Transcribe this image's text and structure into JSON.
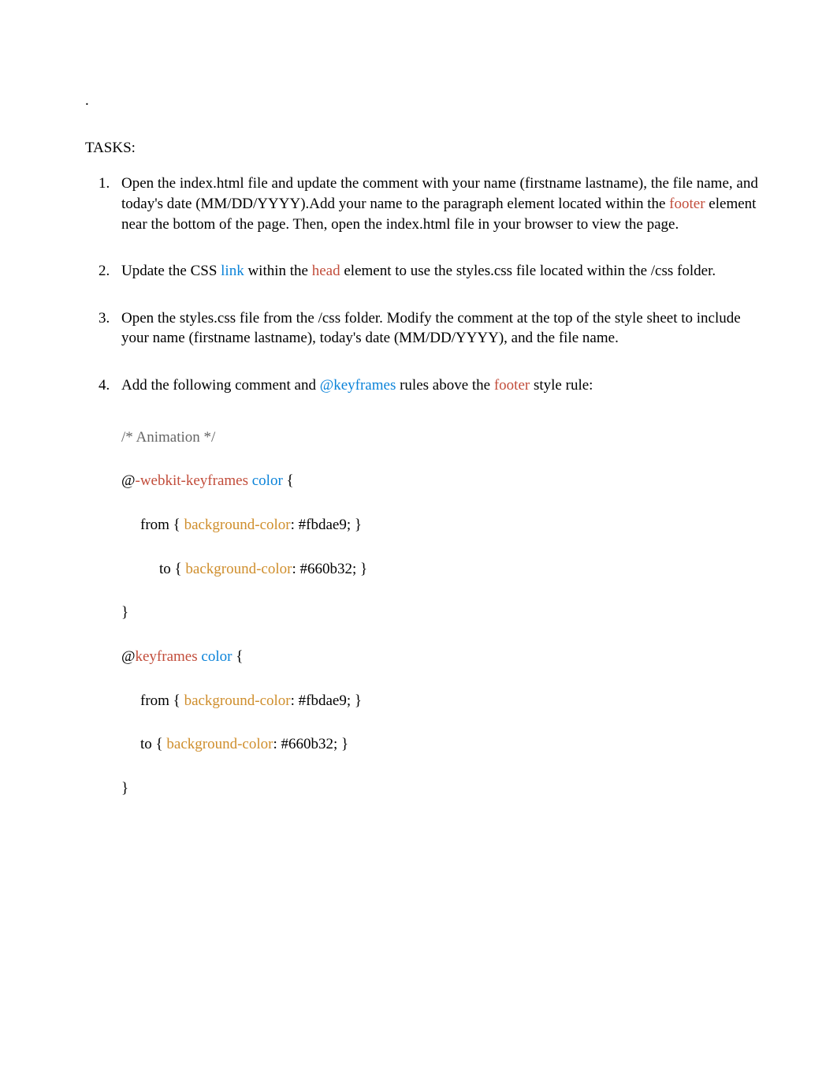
{
  "heading_dot": ".",
  "tasks_label": "TASKS:",
  "items": {
    "i1": {
      "t1": "Open the ",
      "file1": "index.html",
      "t2": " file and update the comment with ",
      "yourname": "your name",
      "t3": " (firstname lastname), the ",
      "filename": "file name",
      "t4": ", and ",
      "todaysdate": "today's date",
      "t5": " (MM/DD/YYYY).Add your name to the paragraph element located within the ",
      "footer": "footer",
      "t6": " element near the bottom of the page. Then, open the ",
      "file2": "index.html",
      "t7": " file in your browser to view the page."
    },
    "i2": {
      "t1": "Update the CSS ",
      "link": "link",
      "t2": " within the ",
      "head": "head",
      "t3": " element to use the ",
      "styles": "styles.css",
      "t4": " file located within the ",
      "css": "/css",
      "t5": " folder."
    },
    "i3": {
      "t1": "Open the ",
      "styles": "styles.css",
      "t2": " file from the ",
      "css": "/css",
      "t3": " folder. Modify the comment at the top of the style sheet to include ",
      "yourname": "your name",
      "t4": " (firstname lastname), ",
      "todaysdate": "today's date",
      "t5": " (MM/DD/YYYY), and the ",
      "filename": "file name",
      "t6": "."
    },
    "i4": {
      "t1": "Add the following comment and ",
      "keyframes": "@keyframes",
      "t2": " rules above the ",
      "footer": "footer",
      "t3": " style rule:"
    }
  },
  "code": {
    "c1": "/* Animation */",
    "c2a": "@",
    "c2b": "-webkit-keyframes",
    "c2c": "color",
    "c2d": " {",
    "c3a": "from { ",
    "c3b": "background-color",
    "c3c": ": #fbdae9; }",
    "c4a": "to { ",
    "c4b": "background-color",
    "c4c": ": #660b32; }",
    "c5": "}",
    "c6a": "@",
    "c6b": "keyframes",
    "c6c": "color",
    "c6d": " {",
    "c7a": "from { ",
    "c7b": "background-color",
    "c7c": ": #fbdae9; }",
    "c8a": "to { ",
    "c8b": "background-color",
    "c8c": ": #660b32; }",
    "c9": "}"
  }
}
